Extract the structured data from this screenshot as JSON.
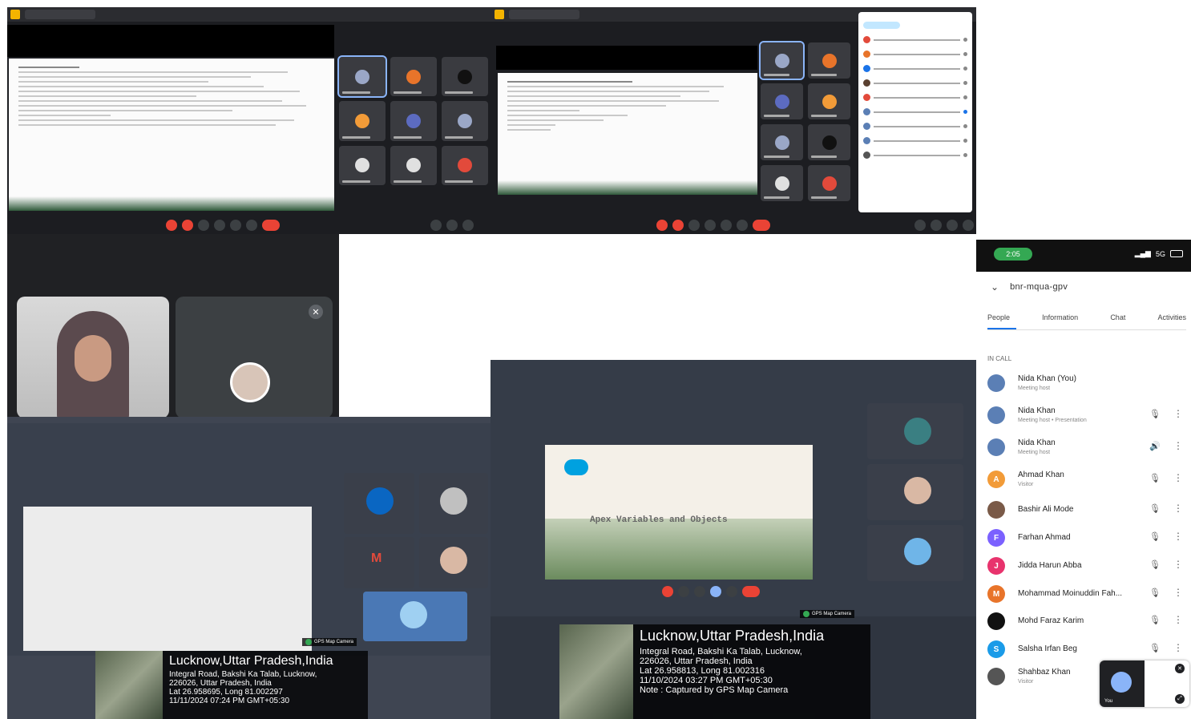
{
  "colors": {
    "meet_dark": "#1c1d21",
    "hangup_red": "#ea4335",
    "accent_blue": "#8ab4f8",
    "status_green": "#34a853"
  },
  "gps_photo_1": {
    "city": "Lucknow,Uttar Pradesh,India",
    "address": "Integral Road, Bakshi Ka Talab, Lucknow,",
    "postcode": "226026, Uttar Pradesh, India",
    "latlong": "Lat 26.958695, Long 81.002297",
    "datetime": "11/11/2024 07:24 PM GMT+05:30",
    "badge": "GPS Map Camera"
  },
  "gps_photo_2": {
    "city": "Lucknow,Uttar Pradesh,India",
    "address": "Integral Road, Bakshi Ka Talab, Lucknow,",
    "postcode": "226026, Uttar Pradesh, India",
    "latlong": "Lat 26.958813, Long 81.002316",
    "datetime": "11/10/2024 03:27 PM GMT+05:30",
    "note": "Note : Captured by GPS Map Camera",
    "badge": "GPS Map Camera"
  },
  "slide": {
    "title": "Apex Variables and Objects"
  },
  "phone": {
    "status_time": "2:05",
    "network": "5G",
    "meeting_code": "bnr-mqua-gpv",
    "tabs": [
      "People",
      "Information",
      "Chat",
      "Activities"
    ],
    "section_label": "IN CALL",
    "participants": [
      {
        "initial": "",
        "name": "Nida Khan (You)",
        "sub": "Meeting host",
        "color": "#5b7fb5",
        "mic": "",
        "more": ""
      },
      {
        "initial": "",
        "name": "Nida Khan",
        "sub": "Meeting host • Presentation",
        "color": "#5b7fb5",
        "mic": "🎙",
        "more": "⋮"
      },
      {
        "initial": "",
        "name": "Nida Khan",
        "sub": "Meeting host",
        "color": "#5b7fb5",
        "mic": "🔊",
        "more": "⋮"
      },
      {
        "initial": "A",
        "name": "Ahmad Khan",
        "sub": "Visitor",
        "color": "#f29b38",
        "mic": "🎙",
        "more": "⋮"
      },
      {
        "initial": "",
        "name": "Bashir Ali Mode",
        "sub": "",
        "color": "#7a5a48",
        "mic": "🎙",
        "more": "⋮"
      },
      {
        "initial": "F",
        "name": "Farhan Ahmad",
        "sub": "",
        "color": "#7b61ff",
        "mic": "🎙",
        "more": "⋮"
      },
      {
        "initial": "J",
        "name": "Jidda Harun Abba",
        "sub": "",
        "color": "#e8336d",
        "mic": "🎙",
        "more": "⋮"
      },
      {
        "initial": "M",
        "name": "Mohammad Moinuddin Fah...",
        "sub": "",
        "color": "#e8742a",
        "mic": "🎙",
        "more": "⋮"
      },
      {
        "initial": "",
        "name": "Mohd Faraz Karim",
        "sub": "",
        "color": "#111111",
        "mic": "🎙",
        "more": "⋮"
      },
      {
        "initial": "S",
        "name": "Salsha Irfan Beg",
        "sub": "",
        "color": "#1a9be8",
        "mic": "🎙",
        "more": "⋮"
      },
      {
        "initial": "",
        "name": "Shahbaz Khan",
        "sub": "Visitor",
        "color": "#555555",
        "mic": "",
        "more": ""
      }
    ],
    "selfview_label": "You"
  },
  "icons": {
    "mic_off": "mic-off-icon",
    "more": "more-vert-icon",
    "chevron": "chevron-down-icon",
    "close": "close-icon"
  }
}
